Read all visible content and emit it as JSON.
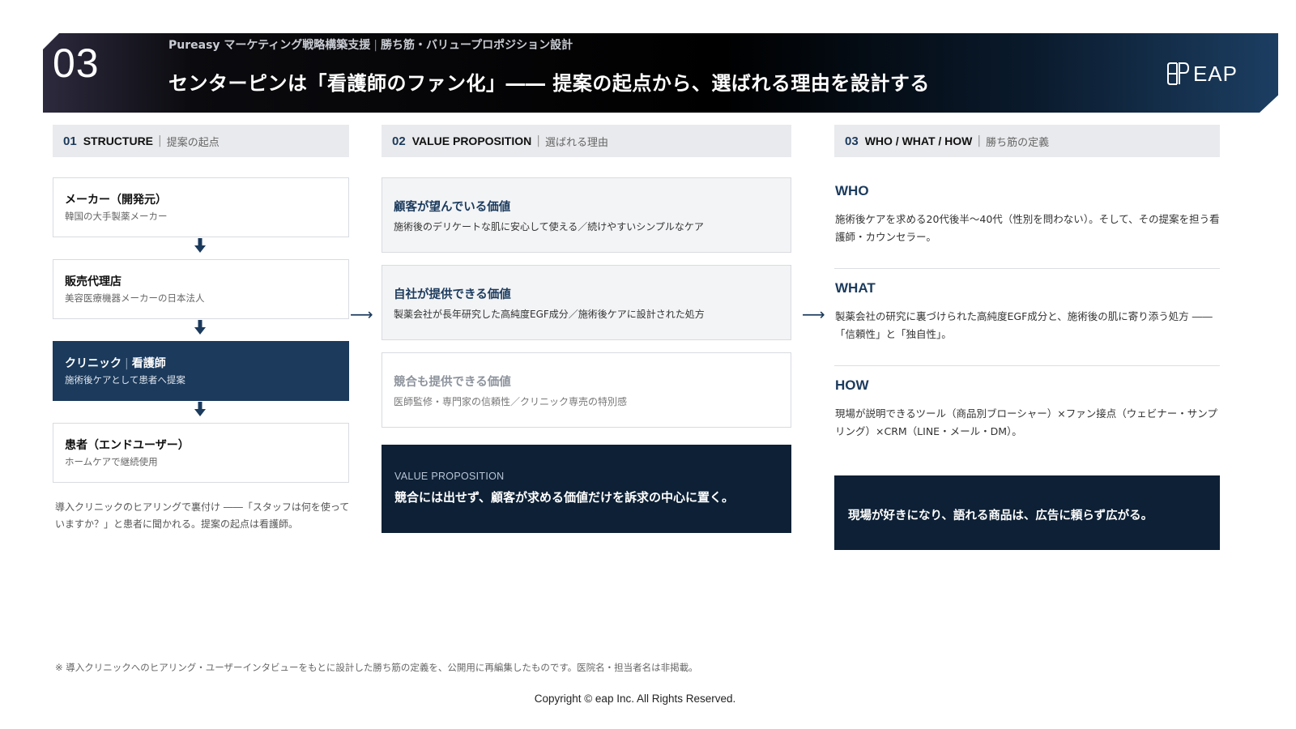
{
  "header": {
    "slide_number": "03",
    "subtitle_left": "Pureasy マーケティング戦略構築支援",
    "subtitle_right": "勝ち筋・バリュープロポジション設計",
    "title": "センターピンは「看護師のファン化」―― 提案の起点から、選ばれる理由を設計する",
    "logo_text": "EAP"
  },
  "sections": [
    {
      "num": "01",
      "en": "STRUCTURE",
      "jp": "提案の起点"
    },
    {
      "num": "02",
      "en": "VALUE PROPOSITION",
      "jp": "選ばれる理由"
    },
    {
      "num": "03",
      "en": "WHO / WHAT / HOW",
      "jp": "勝ち筋の定義"
    }
  ],
  "structure": {
    "steps": [
      {
        "title": "メーカー（開発元）",
        "sub": "韓国の大手製薬メーカー"
      },
      {
        "title": "販売代理店",
        "sub": "美容医療機器メーカーの日本法人"
      },
      {
        "title_a": "クリニック",
        "title_b": "看護師",
        "sub": "施術後ケアとして患者へ提案"
      },
      {
        "title": "患者（エンドユーザー）",
        "sub": "ホームケアで継続使用"
      }
    ],
    "note": "導入クリニックのヒアリングで裏付け ――「スタッフは何を使っていますか？」と患者に聞かれる。提案の起点は看護師。"
  },
  "value_proposition": {
    "items": [
      {
        "title": "顧客が望んでいる価値",
        "sub": "施術後のデリケートな肌に安心して使える／続けやすいシンプルなケア"
      },
      {
        "title": "自社が提供できる価値",
        "sub": "製薬会社が長年研究した高純度EGF成分／施術後ケアに設計された処方"
      },
      {
        "title": "競合も提供できる価値",
        "sub": "医師監修・専門家の信頼性／クリニック専売の特別感"
      }
    ],
    "summary_label": "VALUE PROPOSITION",
    "summary": "競合には出せず、顧客が求める価値だけを訴求の中心に置く。"
  },
  "who_what_how": {
    "items": [
      {
        "heading": "WHO",
        "body": "施術後ケアを求める20代後半〜40代（性別を問わない）。そして、その提案を担う看護師・カウンセラー。"
      },
      {
        "heading": "WHAT",
        "body": "製薬会社の研究に裏づけられた高純度EGF成分と、施術後の肌に寄り添う処方 ――「信頼性」と「独自性」。"
      },
      {
        "heading": "HOW",
        "body": "現場が説明できるツール（商品別ブローシャー）×ファン接点（ウェビナー・サンプリング）×CRM（LINE・メール・DM）。"
      }
    ],
    "summary": "現場が好きになり、語れる商品は、広告に頼らず広がる。"
  },
  "footnote": "※ 導入クリニックへのヒアリング・ユーザーインタビューをもとに設計した勝ち筋の定義を、公開用に再編集したものです。医院名・担当者名は非掲載。",
  "copyright": "Copyright © eap Inc. All Rights Reserved.",
  "colors": {
    "navy": "#1b3a5c",
    "dark_navy": "#0d2035",
    "panel_gray": "#e9eaed"
  }
}
